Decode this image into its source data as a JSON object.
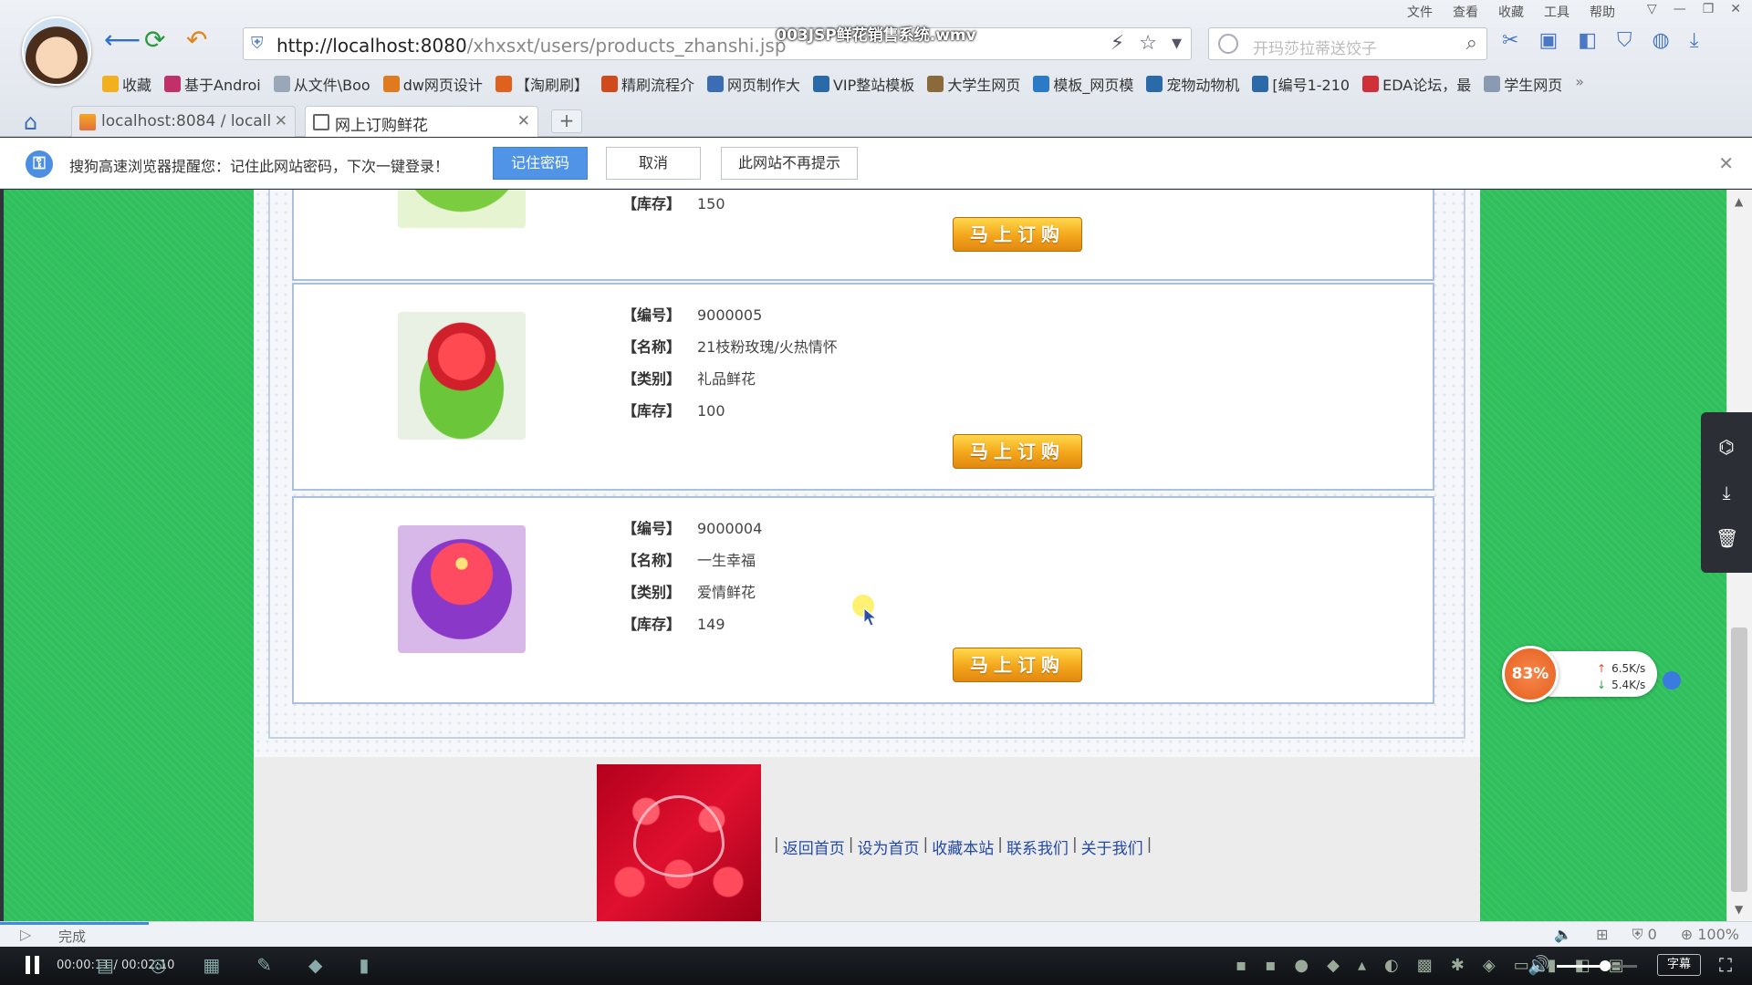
{
  "video": {
    "title": "003JSP鲜花销售系统.wmv",
    "time": "00:00:11 / 00:02:10",
    "progress": 0.085,
    "volume": 0.6,
    "subtitle_label": "字幕"
  },
  "window": {
    "menu": [
      "文件",
      "查看",
      "收藏",
      "工具",
      "帮助"
    ],
    "buttons": [
      "▽",
      "—",
      "❐",
      "✕"
    ]
  },
  "addressbar": {
    "url_host": "http://localhost:8080",
    "url_path": "/xhxsxt/users/products_zhanshi.jsp"
  },
  "search": {
    "placeholder": "开玛莎拉蒂送饺子"
  },
  "bookmarks": [
    {
      "label": "收藏",
      "color": "#f2b01e"
    },
    {
      "label": "基于Androi",
      "color": "#c0306a"
    },
    {
      "label": "从文件\\Boo",
      "color": "#9aa7b8"
    },
    {
      "label": "dw网页设计",
      "color": "#e07a1e"
    },
    {
      "label": "【淘刷刷】",
      "color": "#e0601e"
    },
    {
      "label": "精刷流程介",
      "color": "#d04a1e"
    },
    {
      "label": "网页制作大",
      "color": "#3a6db3"
    },
    {
      "label": "VIP整站模板",
      "color": "#2a6aa8"
    },
    {
      "label": "大学生网页",
      "color": "#8a6a3a"
    },
    {
      "label": "模板_网页模",
      "color": "#2a7ac8"
    },
    {
      "label": "宠物动物机",
      "color": "#2a6aa8"
    },
    {
      "label": "[编号1-210",
      "color": "#2a6aa8"
    },
    {
      "label": "EDA论坛，最",
      "color": "#d0303a"
    },
    {
      "label": "学生网页",
      "color": "#8a9ab0"
    }
  ],
  "tabs": [
    {
      "label": "localhost:8084 / locall",
      "close": "✕"
    },
    {
      "label": "网上订购鲜花",
      "close": "✕"
    }
  ],
  "new_tab": "+",
  "infobar": {
    "message": "搜狗高速浏览器提醒您：记住此网站密码，下次一键登录！",
    "remember": "记住密码",
    "cancel": "取消",
    "never": "此网站不再提示"
  },
  "products": [
    {
      "fields": [
        {
          "label": "【库存】",
          "value": "150"
        }
      ],
      "order_label": "马上订购",
      "image_colors": [
        "#7ccc40",
        "#d8f0a8"
      ]
    },
    {
      "fields": [
        {
          "label": "【编号】",
          "value": "9000005"
        },
        {
          "label": "【名称】",
          "value": "21枝粉玫瑰/火热情怀"
        },
        {
          "label": "【类别】",
          "value": "礼品鲜花"
        },
        {
          "label": "【库存】",
          "value": "100"
        }
      ],
      "order_label": "马上订购",
      "image_colors": [
        "#e0303a",
        "#6cc63a"
      ]
    },
    {
      "fields": [
        {
          "label": "【编号】",
          "value": "9000004"
        },
        {
          "label": "【名称】",
          "value": "一生幸福"
        },
        {
          "label": "【类别】",
          "value": "爱情鲜花"
        },
        {
          "label": "【库存】",
          "value": "149"
        }
      ],
      "order_label": "马上订购",
      "image_colors": [
        "#e0304a",
        "#8a38c8"
      ]
    }
  ],
  "footer": {
    "links": [
      "返回首页",
      "设为首页",
      "收藏本站",
      "联系我们",
      "关于我们"
    ]
  },
  "speed": {
    "percent": "83%",
    "up": "6.5K/s",
    "down": "5.4K/s"
  },
  "status": {
    "text": "完成",
    "count": "0",
    "zoom": "100%"
  },
  "colors": {
    "page_green": "#2fbf5c",
    "order_orange": "#f3a51b",
    "link_blue": "#2249a8"
  }
}
